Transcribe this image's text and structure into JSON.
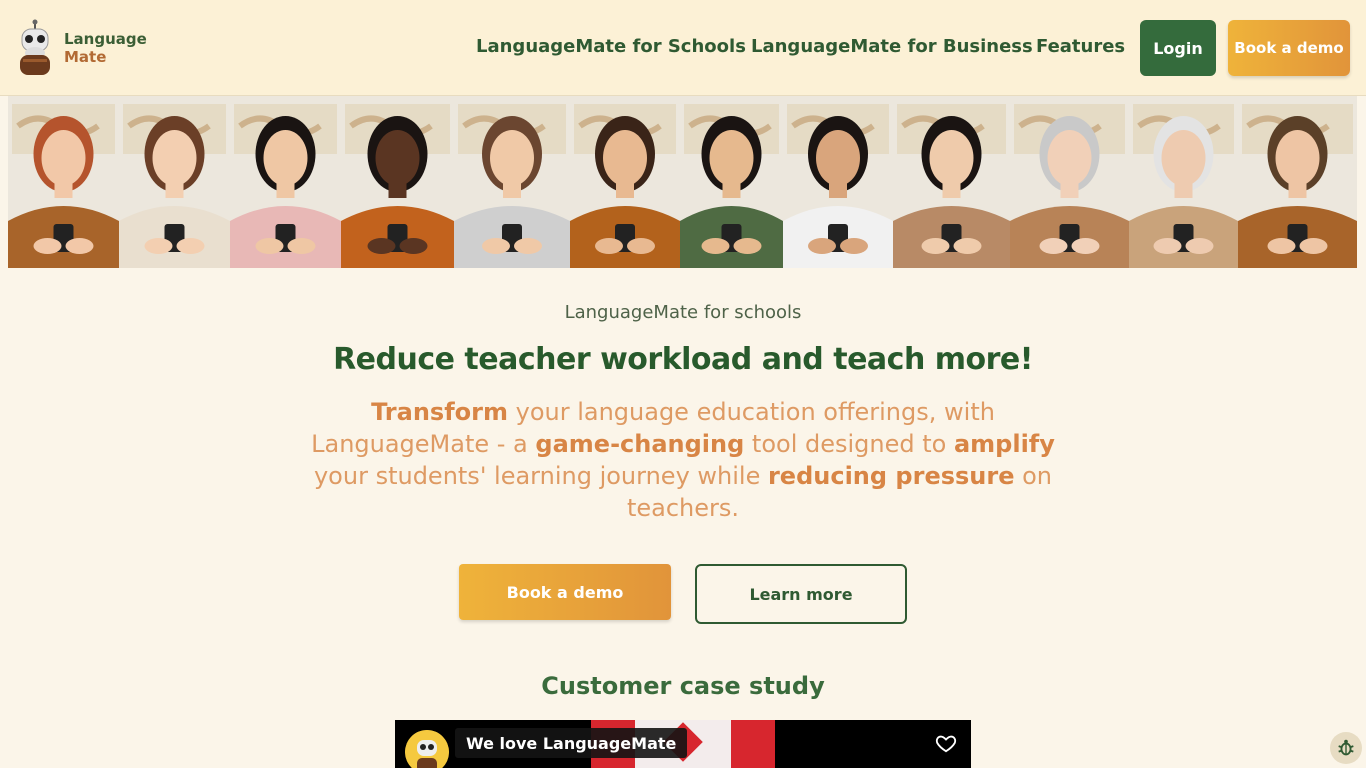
{
  "brand": {
    "name_line1": "Language",
    "name_line2": "Mate",
    "logo_icon": "robot-mascot-icon"
  },
  "nav": {
    "links": [
      {
        "label": "LanguageMate for Schools"
      },
      {
        "label": "LanguageMate for Business"
      },
      {
        "label": "Features"
      }
    ],
    "login_label": "Login",
    "demo_label": "Book a demo"
  },
  "banner": {
    "people_count": 12
  },
  "hero": {
    "kicker": "LanguageMate for schools",
    "headline": "Reduce teacher workload and teach more!",
    "sub_parts": [
      {
        "text": "Transform",
        "bold": true
      },
      {
        "text": " your language education offerings, with LanguageMate - a ",
        "bold": false
      },
      {
        "text": "game-changing",
        "bold": true
      },
      {
        "text": " tool designed to ",
        "bold": false
      },
      {
        "text": "amplify",
        "bold": true
      },
      {
        "text": " your students' learning journey while ",
        "bold": false
      },
      {
        "text": "reducing pressure",
        "bold": true
      },
      {
        "text": " on teachers.",
        "bold": false
      }
    ],
    "primary_button": "Book a demo",
    "secondary_button": "Learn more"
  },
  "case_study": {
    "title": "Customer case study",
    "video_title": "We love LanguageMate",
    "heart_icon": "heart-icon"
  },
  "floating": {
    "icon": "bug-icon"
  },
  "colors": {
    "accent_green": "#2f5a32",
    "accent_orange": "#e1943a",
    "header_bg": "#fcf1d6",
    "page_bg": "#fbf5e9"
  }
}
